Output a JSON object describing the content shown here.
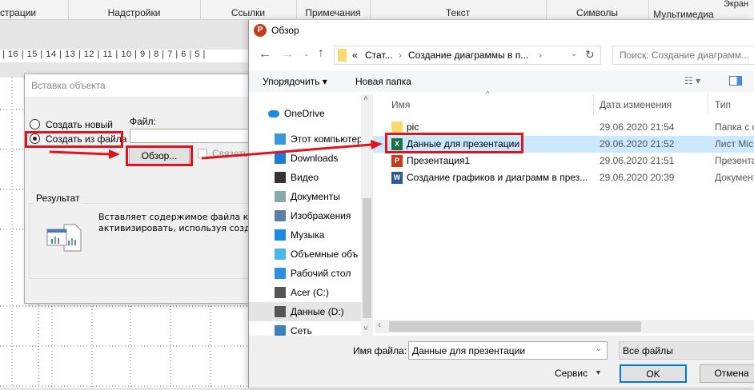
{
  "ribbon": {
    "groups": [
      "страции",
      "Надстройки",
      "Ссылки",
      "Примечания",
      "Текст",
      "Символы",
      "Мультимедиа"
    ],
    "top_right": "Экран"
  },
  "ruler": "| 16 | 15 | 14 | 13 | 12 | 11 | 10 | 9 | 8 | 7 | 6 | 5 |",
  "insert_dialog": {
    "title": "Вставка объекта",
    "radio_new": "Создать новый",
    "radio_from_file": "Создать из файла",
    "selected": "from_file",
    "file_label": "Файл:",
    "file_value": "",
    "browse_button": "Обзор...",
    "link_checkbox": "Связать",
    "link_checked": false,
    "result_label": "Результат",
    "result_text_1": "Вставляет содержимое файла как с",
    "result_text_2": "активизировать, используя создавь"
  },
  "browse_dialog": {
    "title": "Обзор",
    "breadcrumb": [
      "«",
      "Стат...",
      "Создание диаграммы в п..."
    ],
    "search_placeholder": "Поиск: Создание диаграмм...",
    "organize": "Упорядочить ▾",
    "new_folder": "Новая папка",
    "nav": [
      {
        "label": "OneDrive",
        "icon": "cloud-icon"
      },
      {
        "label": "Этот компьютер",
        "icon": "computer-icon"
      },
      {
        "label": "Downloads",
        "icon": "download-icon"
      },
      {
        "label": "Видео",
        "icon": "video-icon"
      },
      {
        "label": "Документы",
        "icon": "documents-icon"
      },
      {
        "label": "Изображения",
        "icon": "pictures-icon"
      },
      {
        "label": "Музыка",
        "icon": "music-icon"
      },
      {
        "label": "Объемные объ",
        "icon": "3d-objects-icon"
      },
      {
        "label": "Рабочий стол",
        "icon": "desktop-icon"
      },
      {
        "label": "Acer (C:)",
        "icon": "drive-icon"
      },
      {
        "label": "Данные (D:)",
        "icon": "drive-icon"
      },
      {
        "label": "Сеть",
        "icon": "network-icon"
      }
    ],
    "nav_selected": "Данные (D:)",
    "columns": [
      "Имя",
      "Дата изменения",
      "Тип"
    ],
    "files": [
      {
        "name": "pic",
        "date": "29.06.2020 21:54",
        "type": "Папка с ф",
        "icon": "folder-icon"
      },
      {
        "name": "Данные для презентации",
        "date": "29.06.2020 21:52",
        "type": "Лист Mic",
        "icon": "excel-icon"
      },
      {
        "name": "Презентация1",
        "date": "29.06.2020 21:51",
        "type": "Презента",
        "icon": "powerpoint-icon"
      },
      {
        "name": "Создание графиков и диаграмм в през...",
        "date": "29.06.2020 20:39",
        "type": "Документ",
        "icon": "word-icon"
      }
    ],
    "selected_file": "Данные для презентации",
    "filename_label": "Имя файла:",
    "filename_value": "Данные для презентации",
    "filter": "Все файлы",
    "service": "Сервис",
    "ok": "OK",
    "cancel": "Отмена"
  },
  "colors": {
    "highlight": "#e0141c",
    "selection": "#cce8ff",
    "accent": "#0078d7"
  }
}
